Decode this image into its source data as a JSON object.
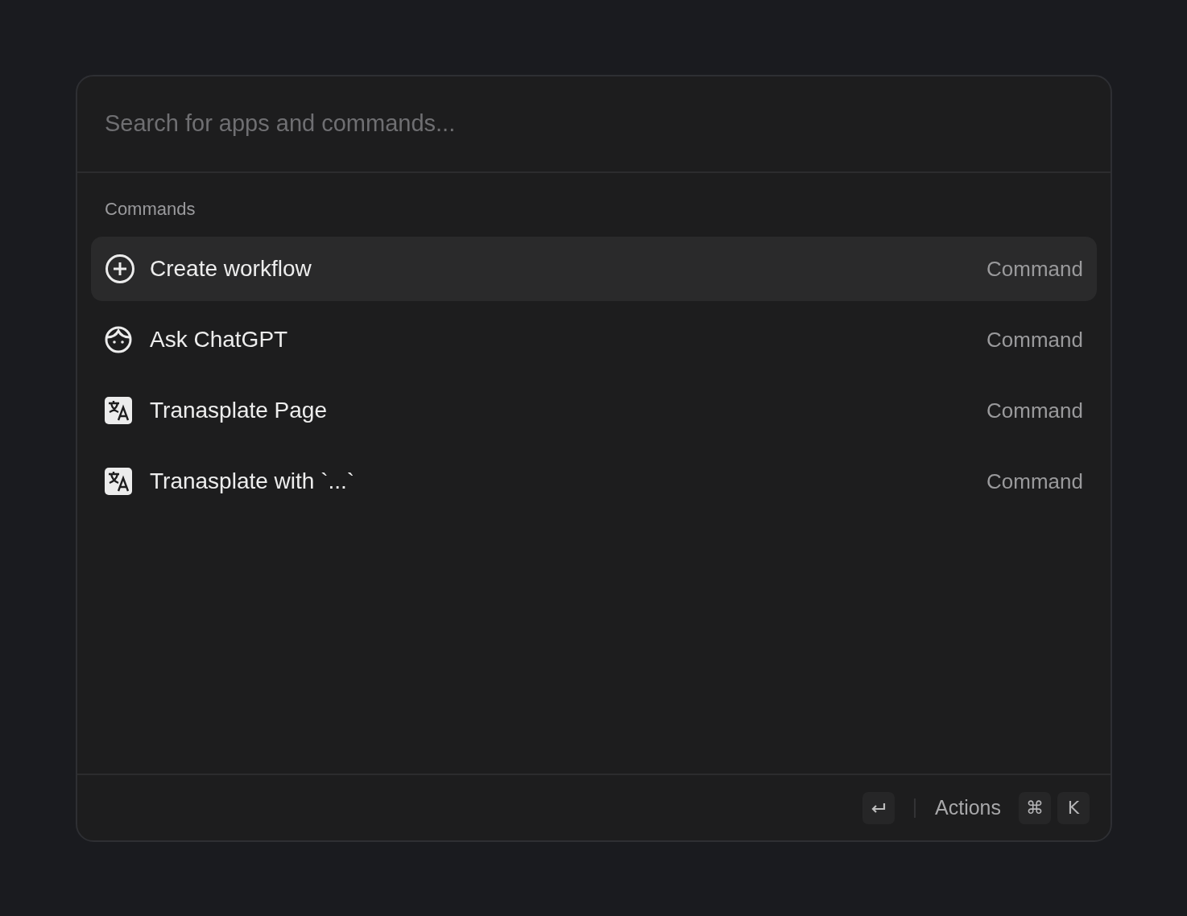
{
  "search": {
    "placeholder": "Search for apps and commands..."
  },
  "section": "Commands",
  "items": [
    {
      "kind": "plus",
      "label": "Create workflow",
      "type": "Command",
      "selected": true
    },
    {
      "kind": "face",
      "label": "Ask ChatGPT",
      "type": "Command",
      "selected": false
    },
    {
      "kind": "translate",
      "label": "Tranasplate Page",
      "type": "Command",
      "selected": false
    },
    {
      "kind": "translate",
      "label": "Tranasplate with `...`",
      "type": "Command",
      "selected": false
    }
  ],
  "footer": {
    "actions_label": "Actions",
    "shortcut_keys": [
      "⌘",
      "K"
    ]
  }
}
